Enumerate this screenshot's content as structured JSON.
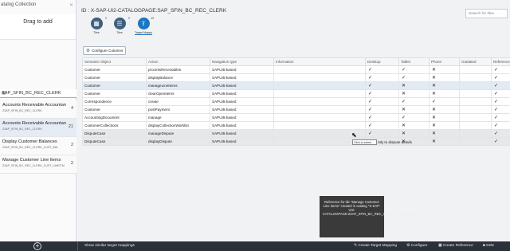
{
  "left_panel": {
    "header": "atalog Collection",
    "drag_label": "Drag to add",
    "search_value": "SAP_SFIN_BC_REC_CLERK",
    "items": [
      {
        "title": "Accounts Receivable Accountant",
        "sub": "Z3AP_SFIN_BC_REC_CLERK",
        "count": "4"
      },
      {
        "title": "Accounts Receivable Accountant",
        "sub": "Z3AP_SFIN_BC_REC_CLERK",
        "count": "21"
      },
      {
        "title": "Display Customer Balances",
        "sub": "Z3AP_SFIN_BC_REC_CLERK_CUST_BAL",
        "count": "2"
      },
      {
        "title": "Manage Customer Line Items",
        "sub": "Z3AP_SFIN_BC_REC_CLERK_CUST_LINEITM",
        "count": "2"
      }
    ]
  },
  "main": {
    "id_line": "ID : X-SAP-UI2-CATALOGPAGE:SAP_SFIN_BC_REC_CLERK",
    "search_placeholder": "Search for tiles",
    "tiles": [
      {
        "label": "Tiles",
        "count": "2"
      },
      {
        "label": "Tiles",
        "count": "0"
      },
      {
        "label": "Target Mapps",
        "count": "13"
      }
    ],
    "configure_label": "Configure Columns",
    "columns": [
      "Semantic Object",
      "Action",
      "Navigation type",
      "Information",
      "Desktop",
      "Tablet",
      "Phone",
      "Outdated",
      "Reference"
    ],
    "rows": [
      {
        "obj": "Customer",
        "action": "processReceivables",
        "nav": "SAPUI5-based",
        "info": "",
        "d": "✓",
        "t": "✓",
        "p": "✕",
        "o": "",
        "r": "✓"
      },
      {
        "obj": "Customer",
        "action": "displayBalance",
        "nav": "SAPUI5-based",
        "info": "",
        "d": "✓",
        "t": "✓",
        "p": "✕",
        "o": "",
        "r": "✓"
      },
      {
        "obj": "Customer",
        "action": "manageLineItems",
        "nav": "SAPUI5-based",
        "info": "",
        "d": "✓",
        "t": "✕",
        "p": "✕",
        "o": "",
        "r": "✓"
      },
      {
        "obj": "Customer",
        "action": "clearOpenItems",
        "nav": "SAPUI5-based",
        "info": "",
        "d": "✓",
        "t": "✕",
        "p": "✕",
        "o": "",
        "r": "✓"
      },
      {
        "obj": "Correspondence",
        "action": "create",
        "nav": "SAPUI5-based",
        "info": "",
        "d": "✓",
        "t": "✓",
        "p": "✓",
        "o": "",
        "r": "✓"
      },
      {
        "obj": "Customer",
        "action": "postPayment",
        "nav": "SAPUI5-based",
        "info": "",
        "d": "✓",
        "t": "✕",
        "p": "✕",
        "o": "",
        "r": "✓"
      },
      {
        "obj": "AccountingDocument",
        "action": "manage",
        "nav": "SAPUI5-based",
        "info": "",
        "d": "✓",
        "t": "✓",
        "p": "✕",
        "o": "",
        "r": "✓"
      },
      {
        "obj": "CustomerCollections",
        "action": "displayCollectionWorklist",
        "nav": "SAPUI5-based",
        "info": "",
        "d": "✓",
        "t": "✕",
        "p": "✕",
        "o": "",
        "r": "✓"
      },
      {
        "obj": "DisputeCase",
        "action": "manageDispute",
        "nav": "SAPUI5-based",
        "info": "",
        "d": "✓",
        "t": "✕",
        "p": "✕",
        "o": "",
        "r": "✓"
      },
      {
        "obj": "DisputeCase",
        "action": "displayDispute",
        "nav": "SAPUI5-based",
        "info": "",
        "d": "✓",
        "t": "✕",
        "p": "✕",
        "o": "",
        "r": "✓"
      }
    ],
    "tooltip": "Click to select",
    "tooltip_tail": "ntly to dispute details",
    "popup": "Reference for tile \"Manage Customer Line Items\" created in catalog \"X-SAP-UI2-CATALOGPAGE:Z3AP_SFIN_BC_REC_CLERK_CUST_LINEITM\""
  },
  "bottom_bar": {
    "show_similar": "Show similar target mappings",
    "create_tm": "Create Target Mapping",
    "configure": "Configure",
    "create_ref": "Create Reference",
    "delete": "Dele"
  }
}
